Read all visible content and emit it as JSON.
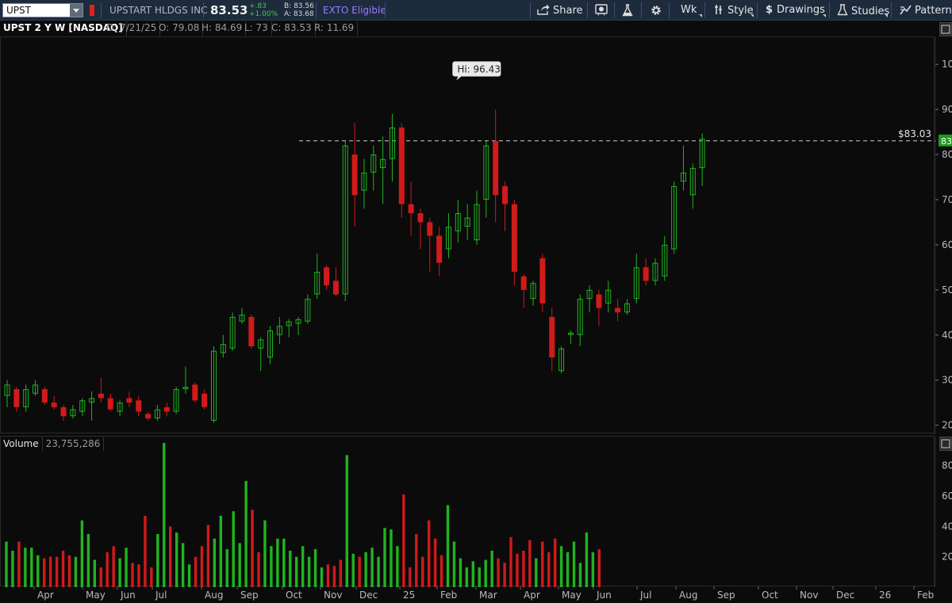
{
  "toolbar": {
    "symbol": "UPST",
    "company": "UPSTART HLDGS INC",
    "last": "83.53",
    "change": "+.83",
    "change_pct": "+1.00%",
    "bid": "B: 83.56",
    "ask": "A: 83.68",
    "exto": "EXTO Eligible",
    "share": "Share",
    "period": "Wk",
    "style": "Style",
    "drawings": "Drawings",
    "studies": "Studies",
    "patterns": "Patterns"
  },
  "infobar": {
    "title": "UPST 2 Y W [NASDAQ]",
    "date": "D: 7/21/25",
    "open": "O: 79.08",
    "high": "H: 84.69",
    "low": "L: 73",
    "close": "C: 83.53",
    "range": "R: 11.69"
  },
  "volume_label": "Volume",
  "volume_value": "23,755,286",
  "price_line_label": "$83.03",
  "price_tag": "83",
  "hi_bubble": "Hi: 96.43",
  "price_axis_labels": [
    "10",
    "90",
    "80",
    "70",
    "60",
    "50",
    "40",
    "30",
    "20"
  ],
  "volume_axis_labels": [
    "80",
    "60",
    "40",
    "20"
  ],
  "month_labels": [
    "Apr",
    "May",
    "Jun",
    "Jul",
    "Aug",
    "Sep",
    "Oct",
    "Nov",
    "Dec",
    "25",
    "Feb",
    "Mar",
    "Apr",
    "May",
    "Jun",
    "Jul",
    "Aug",
    "Sep",
    "Oct",
    "Nov",
    "Dec",
    "26",
    "Feb"
  ],
  "colors": {
    "up": "#1fb41f",
    "down": "#d11a1a",
    "toolbar": "#1d2b3c",
    "background": "#0b0b0b"
  },
  "chart_data": {
    "type": "candlestick",
    "ylim": [
      18,
      106
    ],
    "volume_ylim": [
      0,
      95
    ],
    "last_price_line": 83.03,
    "high_marker": 96.43,
    "candles": [
      {
        "o": 26.5,
        "h": 30,
        "l": 24,
        "c": 29
      },
      {
        "o": 28,
        "h": 28.5,
        "l": 23,
        "c": 24
      },
      {
        "o": 24,
        "h": 29,
        "l": 23,
        "c": 28
      },
      {
        "o": 27,
        "h": 30,
        "l": 26.5,
        "c": 29
      },
      {
        "o": 28,
        "h": 28.5,
        "l": 24.5,
        "c": 25
      },
      {
        "o": 25,
        "h": 26.5,
        "l": 23.5,
        "c": 24
      },
      {
        "o": 24,
        "h": 24.5,
        "l": 21,
        "c": 22
      },
      {
        "o": 22,
        "h": 24.5,
        "l": 21.5,
        "c": 23.5
      },
      {
        "o": 23,
        "h": 26,
        "l": 22,
        "c": 25.5
      },
      {
        "o": 25,
        "h": 27.5,
        "l": 21,
        "c": 26
      },
      {
        "o": 27,
        "h": 30.5,
        "l": 25,
        "c": 26
      },
      {
        "o": 26,
        "h": 27,
        "l": 23,
        "c": 23.5
      },
      {
        "o": 23,
        "h": 25.5,
        "l": 22,
        "c": 25
      },
      {
        "o": 26,
        "h": 27.5,
        "l": 24,
        "c": 25
      },
      {
        "o": 25.5,
        "h": 26.5,
        "l": 22,
        "c": 23
      },
      {
        "o": 22.5,
        "h": 23,
        "l": 21,
        "c": 21.5
      },
      {
        "o": 21.5,
        "h": 24.5,
        "l": 21,
        "c": 23.5
      },
      {
        "o": 24,
        "h": 25,
        "l": 22,
        "c": 23
      },
      {
        "o": 23,
        "h": 28.5,
        "l": 22.5,
        "c": 28
      },
      {
        "o": 28,
        "h": 33,
        "l": 27,
        "c": 28.5
      },
      {
        "o": 29,
        "h": 29.5,
        "l": 25,
        "c": 25.5
      },
      {
        "o": 27,
        "h": 28,
        "l": 23.5,
        "c": 24
      },
      {
        "o": 21,
        "h": 37.5,
        "l": 20.5,
        "c": 36.5
      },
      {
        "o": 36,
        "h": 40,
        "l": 35,
        "c": 38
      },
      {
        "o": 37,
        "h": 45,
        "l": 36.5,
        "c": 44
      },
      {
        "o": 43,
        "h": 46,
        "l": 42.5,
        "c": 44.5
      },
      {
        "o": 44,
        "h": 44.5,
        "l": 37,
        "c": 37.5
      },
      {
        "o": 37,
        "h": 39.5,
        "l": 32,
        "c": 39
      },
      {
        "o": 35,
        "h": 42,
        "l": 33.5,
        "c": 41
      },
      {
        "o": 40,
        "h": 44,
        "l": 38,
        "c": 42
      },
      {
        "o": 42,
        "h": 43.5,
        "l": 39.5,
        "c": 43
      },
      {
        "o": 42.5,
        "h": 44,
        "l": 40,
        "c": 43.5
      },
      {
        "o": 43,
        "h": 49,
        "l": 42.5,
        "c": 48
      },
      {
        "o": 49,
        "h": 58,
        "l": 48,
        "c": 54
      },
      {
        "o": 55,
        "h": 55.5,
        "l": 50,
        "c": 51
      },
      {
        "o": 52,
        "h": 55,
        "l": 48.5,
        "c": 49
      },
      {
        "o": 49,
        "h": 83,
        "l": 47.5,
        "c": 82
      },
      {
        "o": 80,
        "h": 87,
        "l": 64,
        "c": 71
      },
      {
        "o": 72,
        "h": 79,
        "l": 68,
        "c": 76
      },
      {
        "o": 76,
        "h": 82,
        "l": 72,
        "c": 80
      },
      {
        "o": 77,
        "h": 84,
        "l": 69,
        "c": 79
      },
      {
        "o": 79,
        "h": 89,
        "l": 74,
        "c": 86
      },
      {
        "o": 86,
        "h": 87,
        "l": 66,
        "c": 69
      },
      {
        "o": 69,
        "h": 74,
        "l": 62,
        "c": 67
      },
      {
        "o": 67,
        "h": 68,
        "l": 59,
        "c": 65
      },
      {
        "o": 65,
        "h": 66,
        "l": 54,
        "c": 62
      },
      {
        "o": 62,
        "h": 64,
        "l": 53,
        "c": 56
      },
      {
        "o": 59,
        "h": 67,
        "l": 57,
        "c": 64
      },
      {
        "o": 63,
        "h": 70,
        "l": 60.5,
        "c": 67
      },
      {
        "o": 64,
        "h": 69,
        "l": 61,
        "c": 66
      },
      {
        "o": 61,
        "h": 72,
        "l": 60,
        "c": 69
      },
      {
        "o": 70,
        "h": 83,
        "l": 66,
        "c": 82
      },
      {
        "o": 83,
        "h": 90,
        "l": 65,
        "c": 71
      },
      {
        "o": 73,
        "h": 74,
        "l": 63,
        "c": 69
      },
      {
        "o": 69,
        "h": 70,
        "l": 51,
        "c": 54
      },
      {
        "o": 53,
        "h": 53.5,
        "l": 46,
        "c": 50
      },
      {
        "o": 48,
        "h": 52,
        "l": 46.5,
        "c": 51.5
      },
      {
        "o": 57,
        "h": 58,
        "l": 45,
        "c": 47
      },
      {
        "o": 44,
        "h": 46,
        "l": 32,
        "c": 35
      },
      {
        "o": 32,
        "h": 37.5,
        "l": 31.5,
        "c": 37
      },
      {
        "o": 40,
        "h": 41,
        "l": 38,
        "c": 40.5
      },
      {
        "o": 40,
        "h": 49,
        "l": 37.5,
        "c": 48
      },
      {
        "o": 48,
        "h": 51,
        "l": 45,
        "c": 50
      },
      {
        "o": 49,
        "h": 50,
        "l": 42,
        "c": 46
      },
      {
        "o": 47,
        "h": 52,
        "l": 45,
        "c": 50
      },
      {
        "o": 46,
        "h": 48,
        "l": 43,
        "c": 45
      },
      {
        "o": 45,
        "h": 48,
        "l": 44.5,
        "c": 47
      },
      {
        "o": 48,
        "h": 58,
        "l": 47,
        "c": 55
      },
      {
        "o": 55,
        "h": 57,
        "l": 51,
        "c": 52
      },
      {
        "o": 52,
        "h": 57,
        "l": 51,
        "c": 56
      },
      {
        "o": 53,
        "h": 62,
        "l": 52,
        "c": 60
      },
      {
        "o": 59,
        "h": 74,
        "l": 58,
        "c": 73
      },
      {
        "o": 74,
        "h": 82,
        "l": 72,
        "c": 76
      },
      {
        "o": 71,
        "h": 78,
        "l": 68,
        "c": 77
      },
      {
        "o": 77,
        "h": 84.7,
        "l": 73,
        "c": 83.5
      }
    ],
    "volumes": [
      30,
      24,
      30,
      26,
      26,
      21,
      19,
      20,
      20,
      24,
      21,
      20,
      44,
      35,
      18,
      13,
      23,
      27,
      19,
      26,
      16,
      15,
      47,
      13,
      35,
      95,
      40,
      36,
      29,
      15,
      20,
      27,
      41,
      32,
      47,
      25,
      50,
      29,
      70,
      51,
      23,
      44,
      27,
      32,
      32,
      24,
      20,
      27,
      20,
      25,
      13,
      15,
      14,
      18,
      87,
      22,
      20,
      23,
      26,
      20,
      39,
      38,
      27,
      61,
      13,
      35,
      20,
      44,
      32,
      21,
      54,
      30,
      19,
      13,
      17,
      13,
      18,
      24,
      19,
      16,
      33,
      22,
      24,
      31,
      19,
      30,
      23,
      32,
      27,
      23,
      30,
      16,
      36,
      23,
      25
    ]
  }
}
